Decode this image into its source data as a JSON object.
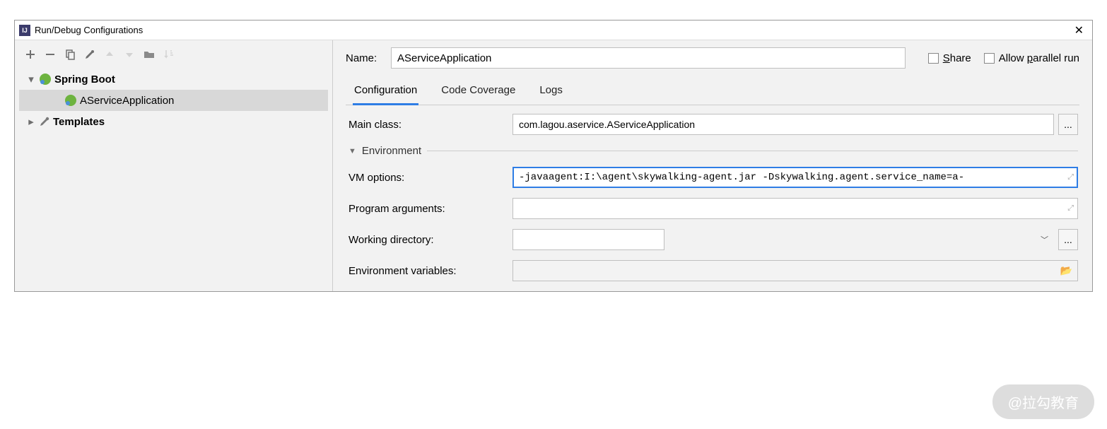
{
  "window": {
    "title": "Run/Debug Configurations"
  },
  "tree": {
    "spring_boot": "Spring Boot",
    "app_item": "AServiceApplication",
    "templates": "Templates"
  },
  "form": {
    "name_label": "Name:",
    "name_value": "AServiceApplication",
    "share_label": "Share",
    "parallel_label": "Allow parallel run",
    "tabs": {
      "config": "Configuration",
      "coverage": "Code Coverage",
      "logs": "Logs"
    },
    "main_class_label": "Main class:",
    "main_class_value": "com.lagou.aservice.AServiceApplication",
    "env_header": "Environment",
    "vm_label": "VM options:",
    "vm_value": "-javaagent:I:\\agent\\skywalking-agent.jar -Dskywalking.agent.service_name=a-",
    "prog_args_label": "Program arguments:",
    "prog_args_value": "",
    "workdir_label": "Working directory:",
    "workdir_value": "",
    "envvars_label": "Environment variables:",
    "envvars_value": "",
    "dots": "..."
  },
  "watermark": "@拉勾教育"
}
